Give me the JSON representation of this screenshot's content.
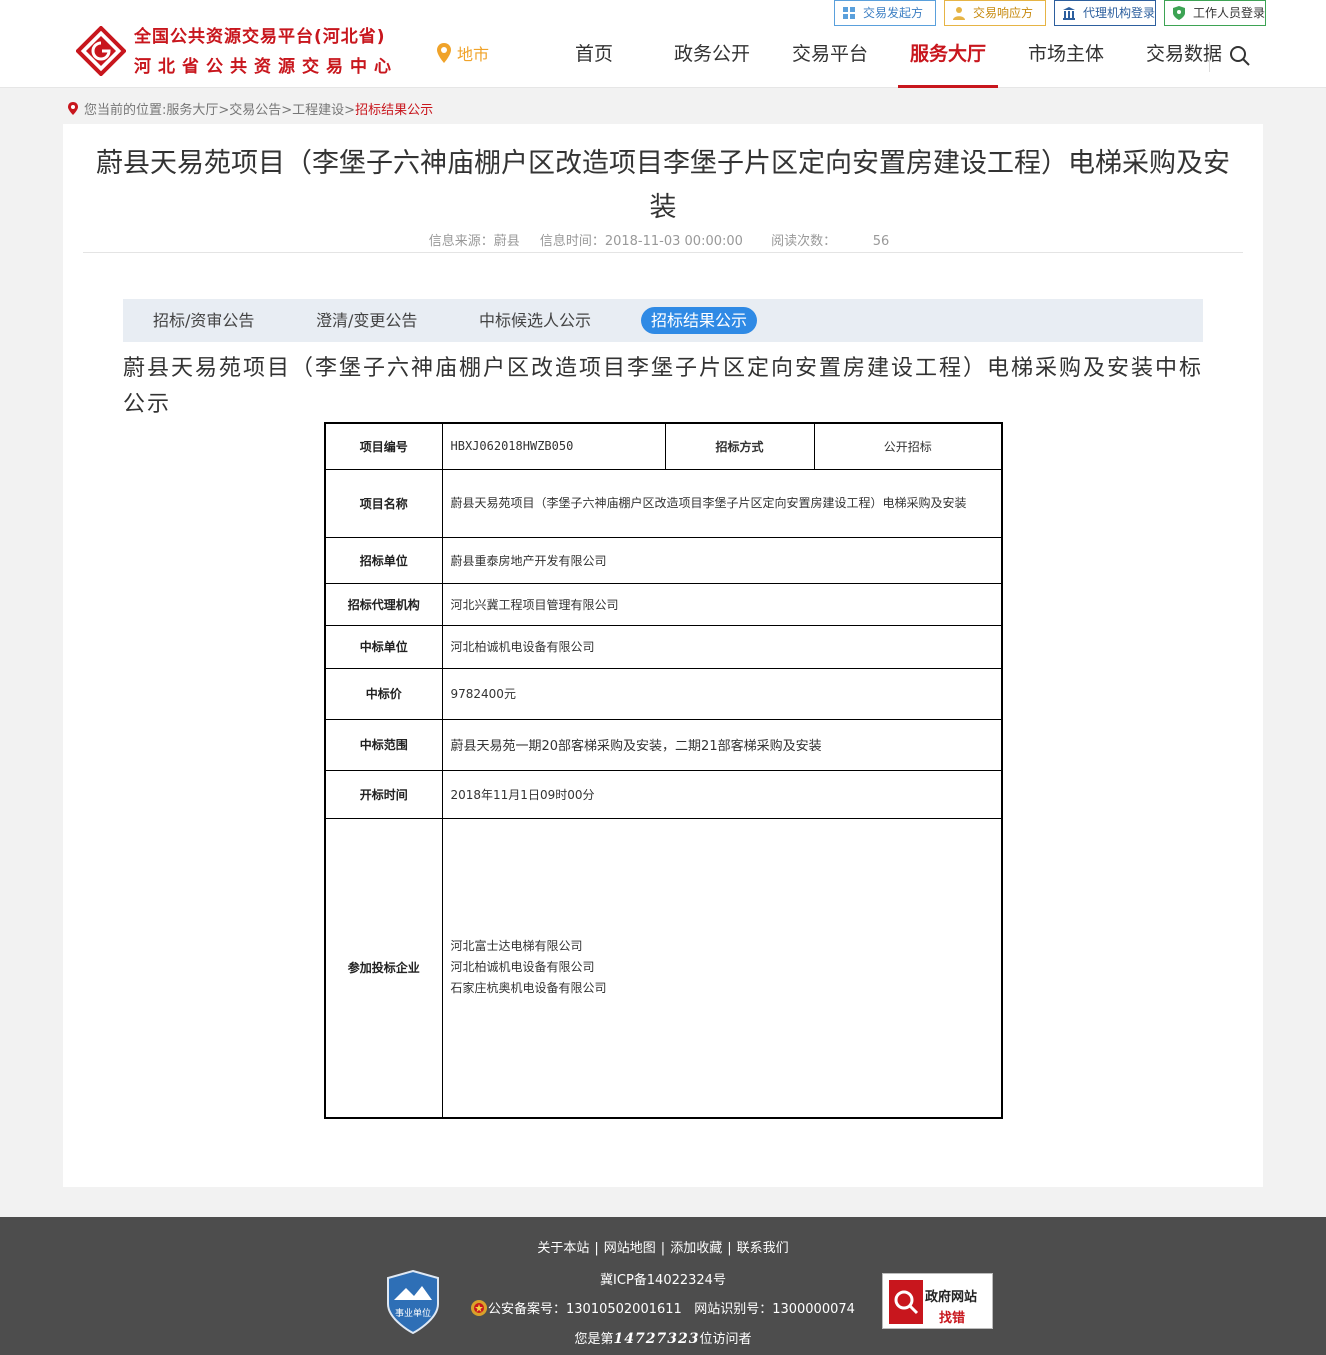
{
  "header": {
    "brand_line1": "全国公共资源交易平台(河北省)",
    "brand_line2": "河北省公共资源交易中心",
    "location": "地市",
    "nav": [
      "首页",
      "政务公开",
      "交易平台",
      "服务大厅",
      "市场主体",
      "交易数据"
    ],
    "active_nav": "服务大厅",
    "top_links": [
      "交易发起方",
      "交易响应方",
      "代理机构登录",
      "工作人员登录"
    ],
    "accent": "#c8161d"
  },
  "breadcrumb": {
    "prefix": "您当前的位置:",
    "path": "服务大厅>交易公告>工程建设>",
    "current": "招标结果公示"
  },
  "article": {
    "title": "蔚县天易苑项目（李堡子六神庙棚户区改造项目李堡子片区定向安置房建设工程）电梯采购及安装",
    "source": "信息来源：蔚县",
    "time": "信息时间：2018-11-03 00:00:00",
    "reads_label": "阅读次数：",
    "reads": "56",
    "tabs": [
      "招标/资审公告",
      "澄清/变更公告",
      "中标候选人公示",
      "招标结果公示"
    ],
    "active_tab": "招标结果公示",
    "tab_active_color": "#2f8ae5",
    "subtitle": "蔚县天易苑项目（李堡子六神庙棚户区改造项目李堡子片区定向安置房建设工程）电梯采购及安装中标公示"
  },
  "table": {
    "project_no_label": "项目编号",
    "project_no": "HBXJ062018HWZB050",
    "method_label": "招标方式",
    "method": "公开招标",
    "name_label": "项目名称",
    "name": "蔚县天易苑项目（李堡子六神庙棚户区改造项目李堡子片区定向安置房建设工程）电梯采购及安装",
    "tenderer_label": "招标单位",
    "tenderer": "蔚县重泰房地产开发有限公司",
    "agent_label": "招标代理机构",
    "agent": "河北兴冀工程项目管理有限公司",
    "winner_label": "中标单位",
    "winner": "河北柏诚机电设备有限公司",
    "price_label": "中标价",
    "price": "9782400元",
    "scope_label": "中标范围",
    "scope": "蔚县天易苑一期20部客梯采购及安装，二期21部客梯采购及安装",
    "open_time_label": "开标时间",
    "open_time": "2018年11月1日09时00分",
    "bidders_label": "参加投标企业",
    "bidders": [
      "河北富士达电梯有限公司",
      "河北柏诚机电设备有限公司",
      "石家庄杭奥机电设备有限公司"
    ]
  },
  "footer": {
    "links": [
      "关于本站",
      "网站地图",
      "添加收藏",
      "联系我们"
    ],
    "icp": "冀ICP备14022324号",
    "police": "公安备案号：13010502001611",
    "site_id": "网站识别号：1300000074",
    "visitor_prefix": "您是第",
    "visitor_count": "14727323",
    "visitor_suffix": "位访问者",
    "badge_left": "事业单位",
    "badge_right_1": "政府网站",
    "badge_right_2": "找错"
  }
}
